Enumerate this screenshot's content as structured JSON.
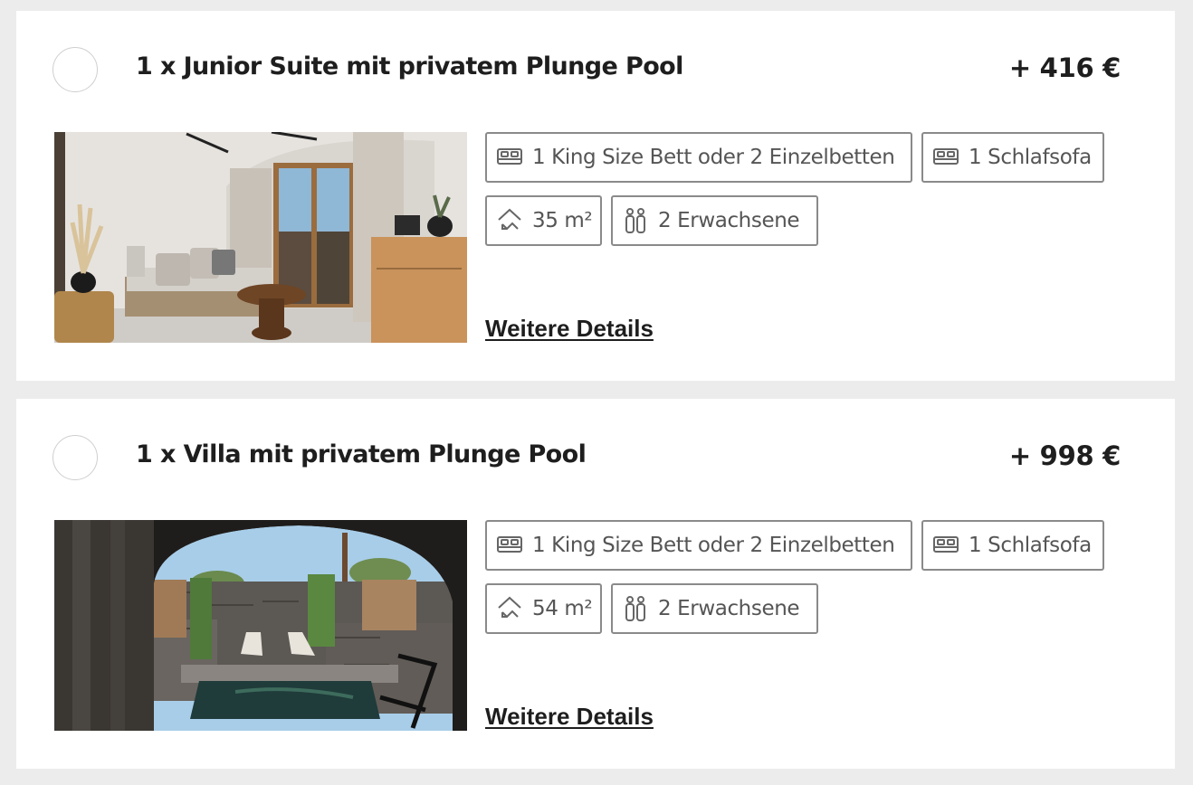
{
  "rooms": [
    {
      "title": "1 x Junior Suite mit privatem Plunge Pool",
      "price": "+ 416 €",
      "features": {
        "bed_primary": "1 King Size Bett oder 2 Einzelbetten",
        "bed_secondary": "1 Schlafsofa",
        "size": "35 m²",
        "persons": "2 Erwachsene"
      },
      "details_link": "Weitere Details",
      "photo": "room-interior-photo"
    },
    {
      "title": "1 x Villa mit privatem Plunge Pool",
      "price": "+ 998 €",
      "features": {
        "bed_primary": "1 King Size Bett oder 2 Einzelbetten",
        "bed_secondary": "1 Schlafsofa",
        "size": "54 m²",
        "persons": "2 Erwachsene"
      },
      "details_link": "Weitere Details",
      "photo": "villa-pool-photo"
    }
  ],
  "icons": {
    "bed": "bed-icon",
    "size": "area-icon",
    "persons": "persons-icon"
  },
  "colors": {
    "page_background": "#ececec",
    "card_background": "#ffffff",
    "chip_border": "#8a8a8a",
    "chip_text": "#555555",
    "title_text": "#1e1e1e"
  }
}
